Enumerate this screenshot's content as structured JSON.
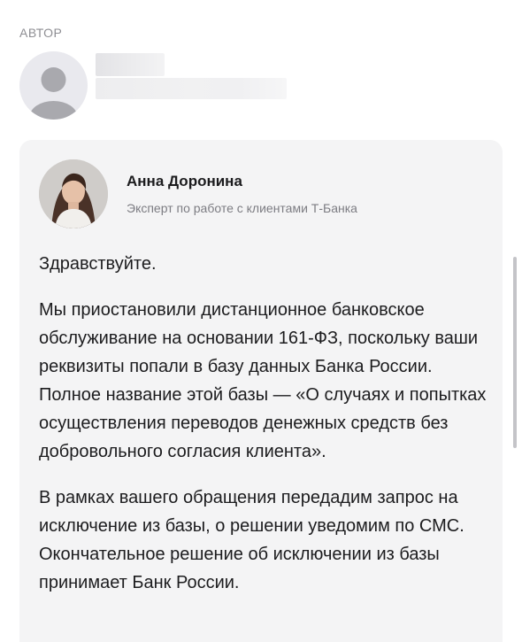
{
  "section": {
    "label": "АВТОР"
  },
  "expert": {
    "name": "Анна Доронина",
    "role": "Эксперт по работе с клиентами Т-Банка"
  },
  "message": {
    "paragraphs": [
      "Здравствуйте.",
      "Мы приостановили дистанционное банковское обслуживание на основании 161-ФЗ, поскольку ваши реквизиты попали в базу данных Банка России. Полное название этой базы — «О случаях и попытках осуществления переводов денежных средств без добровольного согласия клиента».",
      "В рамках вашего обращения передадим запрос на исключение из базы, о решении уведомим по СМС. Окончательное решение об исключении из базы принимает Банк России."
    ]
  },
  "icons": {
    "author_avatar": "user-placeholder-icon"
  }
}
